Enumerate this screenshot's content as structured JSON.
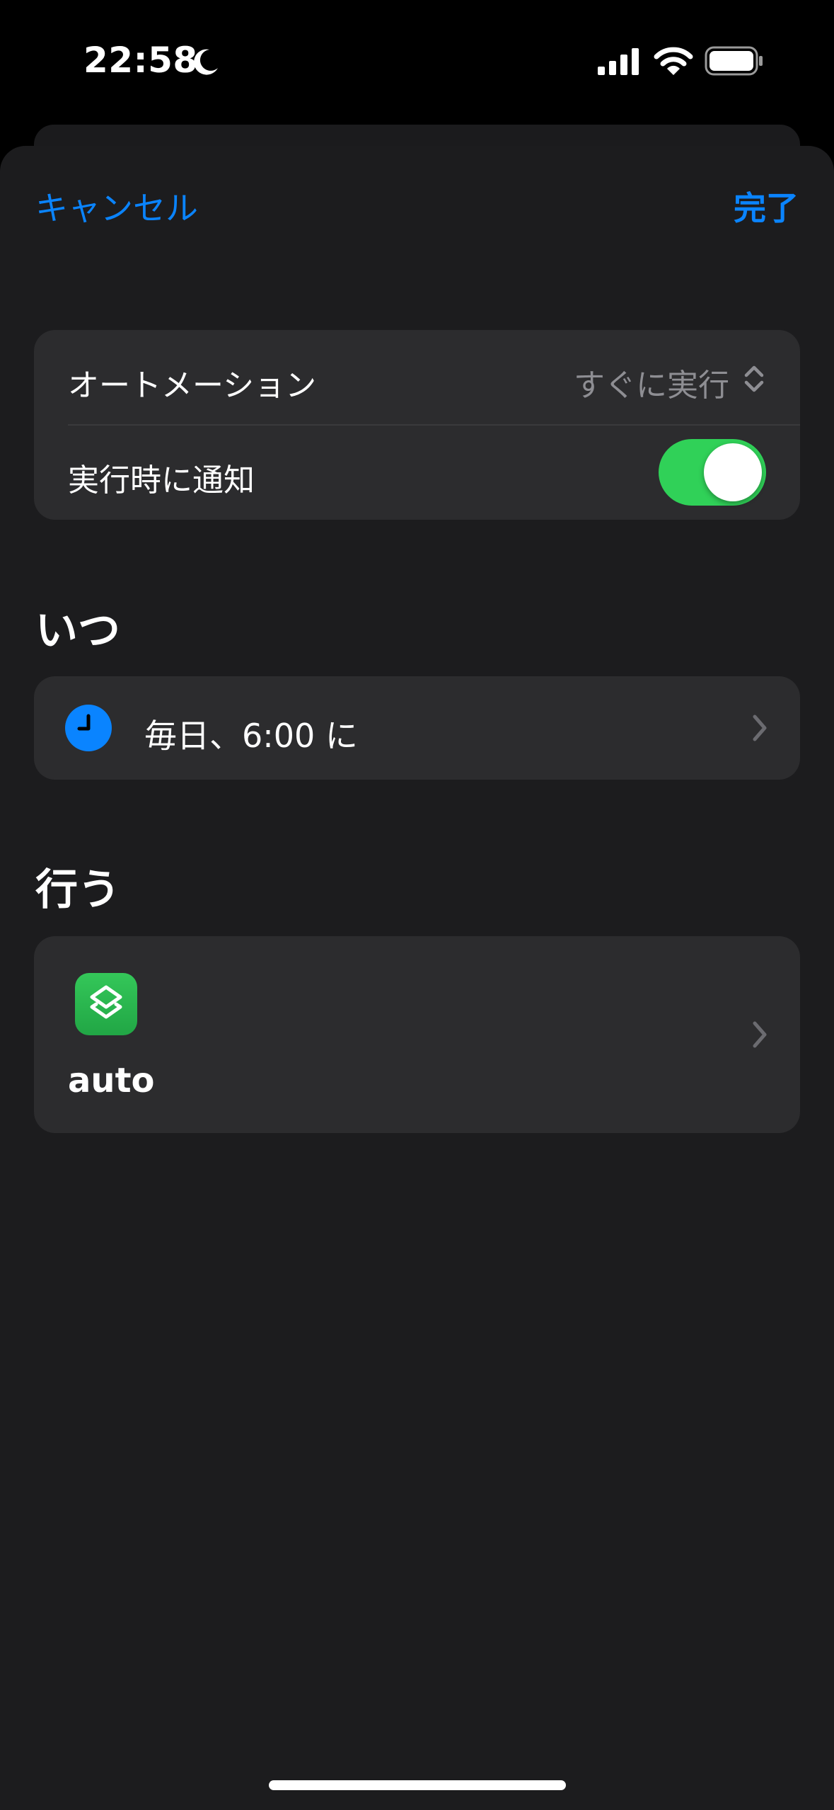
{
  "status_bar": {
    "time": "22:58",
    "icons": [
      "moon-icon",
      "cellular-signal-icon",
      "wifi-icon",
      "battery-icon"
    ]
  },
  "nav": {
    "cancel_label": "キャンセル",
    "done_label": "完了"
  },
  "settings": {
    "automation_label": "オートメーション",
    "automation_value": "すぐに実行",
    "notify_label": "実行時に通知",
    "notify_enabled": true
  },
  "when": {
    "header": "いつ",
    "trigger_label": "毎日、6:00 に",
    "icon": "clock-icon"
  },
  "do": {
    "header": "行う",
    "shortcut_name": "auto",
    "icon": "shortcuts-app-icon"
  },
  "colors": {
    "accent": "#0a84ff",
    "toggle_on": "#30d158",
    "sheet_bg": "#1c1c1e",
    "group_bg": "#2c2c2e",
    "secondary_text": "#8e8e93"
  }
}
